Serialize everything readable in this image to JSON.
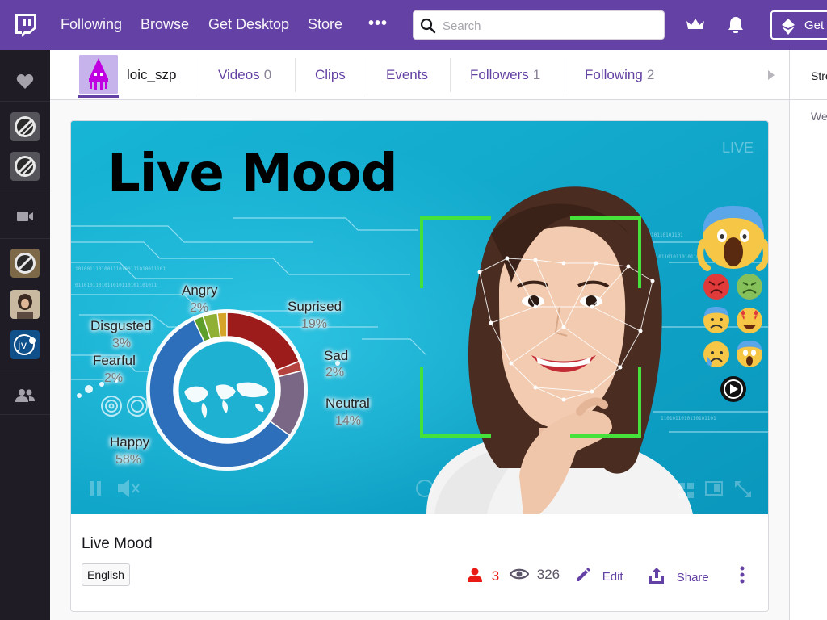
{
  "nav": {
    "links": [
      "Following",
      "Browse",
      "Get Desktop",
      "Store"
    ],
    "more": "•••",
    "search_placeholder": "Search",
    "get_button": "Get"
  },
  "channel": {
    "name": "loic_szp",
    "tabs": [
      {
        "label": "Videos",
        "count": "0"
      },
      {
        "label": "Clips",
        "count": ""
      },
      {
        "label": "Events",
        "count": ""
      },
      {
        "label": "Followers",
        "count": "1"
      },
      {
        "label": "Following",
        "count": "2"
      }
    ]
  },
  "right_panel": {
    "tab": "Stre",
    "text": "We"
  },
  "video": {
    "overlay_title": "Live Mood",
    "live_badge": "LIVE",
    "emotions": [
      {
        "label": "Angry",
        "pct": "2%",
        "color": "#d4a52a"
      },
      {
        "label": "Suprised",
        "pct": "19%",
        "color": "#9c1c1c"
      },
      {
        "label": "Sad",
        "pct": "2%",
        "color": "#b5433f"
      },
      {
        "label": "Neutral",
        "pct": "14%",
        "color": "#7a6786"
      },
      {
        "label": "Happy",
        "pct": "58%",
        "color": "#2d6fba"
      },
      {
        "label": "Fearful",
        "pct": "2%",
        "color": "#5e9e2b"
      },
      {
        "label": "Disgusted",
        "pct": "3%",
        "color": "#8fb034"
      }
    ]
  },
  "stream": {
    "title": "Live Mood",
    "language": "English",
    "viewers": "3",
    "views": "326",
    "edit": "Edit",
    "share": "Share"
  },
  "colors": {
    "brand": "#6441a4",
    "live_red": "#e91916",
    "video_bg": "#15aacb"
  }
}
